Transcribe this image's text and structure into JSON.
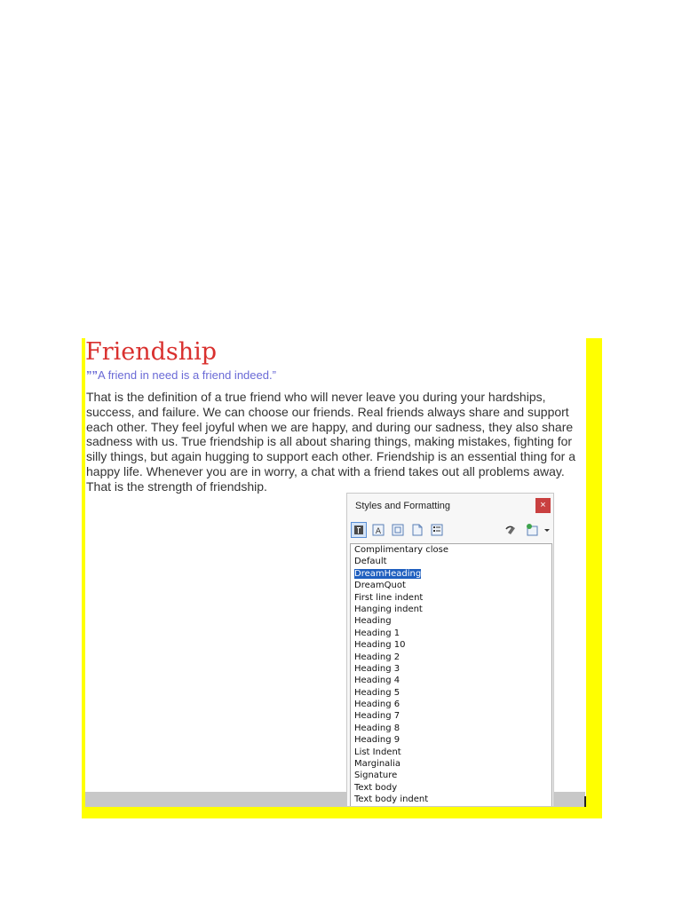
{
  "document": {
    "title": "Friendship",
    "quote_mark": "””",
    "quote": "A friend in need is a friend indeed.”",
    "body_lines": [
      "That is the definition of a true friend who will never leave you during your hardships,",
      "success, and failure. We can choose our friends. Real friends always share and support",
      "each other. They feel joyful when we are happy, and during our sadness, they also share",
      "sadness with us. True friendship is all about sharing things, making mistakes, fighting for",
      "silly things, but again hugging to support each other. Friendship is an essential thing for a",
      "happy life. Whenever you are in worry, a chat with a friend takes out all problems away.",
      "That is the strength of friendship."
    ]
  },
  "panel": {
    "title": "Styles and Formatting",
    "close_glyph": "×",
    "toolbar_icons": [
      "paragraph-styles-icon",
      "character-styles-icon",
      "frame-styles-icon",
      "page-styles-icon",
      "list-styles-icon",
      "fill-format-icon",
      "new-style-icon",
      "dropdown-arrow-icon"
    ],
    "styles": [
      "Complimentary close",
      "Default",
      "DreamHeading",
      "DreamQuot",
      "First line indent",
      "Hanging indent",
      "Heading",
      "Heading 1",
      "Heading 10",
      "Heading 2",
      "Heading 3",
      "Heading 4",
      "Heading 5",
      "Heading 6",
      "Heading 7",
      "Heading 8",
      "Heading 9",
      "List Indent",
      "Marginalia",
      "Signature",
      "Text body",
      "Text body indent"
    ],
    "selected_style": "DreamHeading"
  },
  "colors": {
    "frame_yellow": "#ffff00",
    "title_red": "#d9302e",
    "quote_blue": "#6a6ad6",
    "selection_blue": "#1f5fbf",
    "close_red": "#c94040"
  }
}
